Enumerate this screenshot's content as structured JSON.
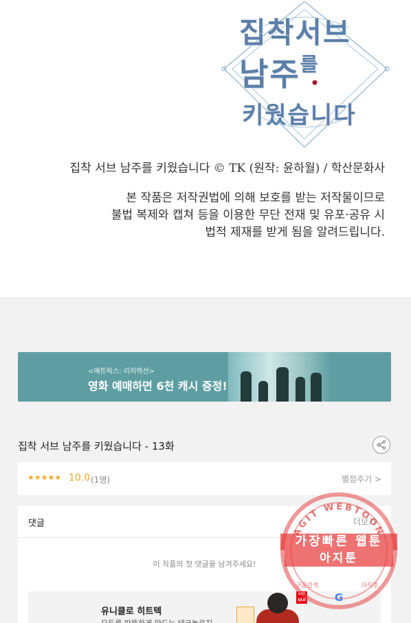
{
  "comic_panel": {
    "logo_line1": "집착서브",
    "logo_line2_main": "남주",
    "logo_line2_small": "를",
    "logo_line3": "키웠습니다",
    "credit": "집착 서브 남주를 키웠습니다 © TK (원작: 윤하월) / 학산문화사",
    "notice_lines": [
      "본 작품은 저작권법에 의해 보호를 받는 저작물이므로",
      "불법 복제와 캡쳐 등을 이용한 무단 전재 및 유포·공유 시",
      "법적 제재를 받게 됨을 알려드립니다."
    ]
  },
  "banner": {
    "subtitle": "<매트릭스: 리저렉션>",
    "title": "영화 예매하면 6천 캐시 증정!",
    "bg_color": "#5e9ea2"
  },
  "episode": {
    "title": "집착 서브 남주를 키웠습니다 - 13화",
    "share_icon": "share-icon"
  },
  "rating": {
    "stars": "★★★★★",
    "score": "10.0",
    "count": "(1명)",
    "rate_link": "별점주기 >",
    "accent_color": "#f5a623"
  },
  "comments": {
    "label": "댓글",
    "more": "더보기",
    "empty_message": "이 작품의 첫 댓글을 남겨주세요!"
  },
  "ad": {
    "title": "유니클로 히트텍",
    "description": "모두를 따뜻하게 만드는 테크놀로지",
    "brand": "UNI QLO"
  },
  "watermark": {
    "arc_text": "AGIT WEBTOON",
    "line1": "가장빠른 웹툰",
    "line2": "아지툰",
    "bottom_left": "구글검색",
    "bottom_right": "아지툰",
    "color": "#e73c3c"
  }
}
